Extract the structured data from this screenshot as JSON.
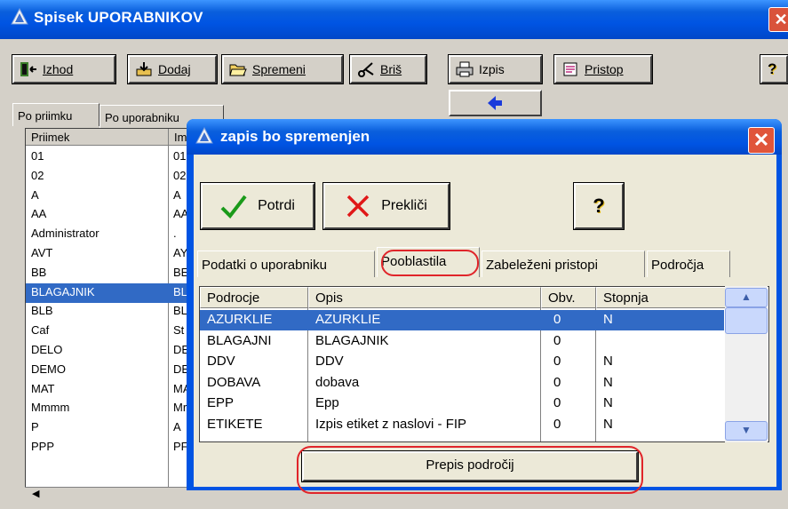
{
  "main_window": {
    "title": "Spisek UPORABNIKOV",
    "toolbar": {
      "exit_label": "Izhod",
      "add_label": "Dodaj",
      "edit_label": "Spremeni",
      "delete_label": "Briš",
      "print_label": "Izpis",
      "access_label": "Pristop",
      "help_icon": "help-icon"
    },
    "tabs": [
      "Po priimku",
      "Po uporabniku"
    ],
    "list": {
      "columns": [
        "Priimek",
        "Im"
      ],
      "rows": [
        [
          "01",
          "01"
        ],
        [
          "02",
          "02"
        ],
        [
          "A",
          "A"
        ],
        [
          "AA",
          "AA"
        ],
        [
          "Administrator",
          "."
        ],
        [
          "AVT",
          "AY"
        ],
        [
          "BB",
          "BE"
        ],
        [
          "BLAGAJNIK",
          "BL"
        ],
        [
          "BLB",
          "BL"
        ],
        [
          "Caf",
          "St"
        ],
        [
          "DELO",
          "DE"
        ],
        [
          "DEMO",
          "DE"
        ],
        [
          "MAT",
          "MA"
        ],
        [
          "Mmmm",
          "Mr"
        ],
        [
          "P",
          "A"
        ],
        [
          "PPP",
          "PF"
        ]
      ],
      "selected_index": 7
    }
  },
  "dialog": {
    "title": "zapis bo spremenjen",
    "confirm_label": "Potrdi",
    "cancel_label": "Prekliči",
    "tabs": [
      "Podatki o uporabniku",
      "Pooblastila",
      "Zabeleženi pristopi",
      "Področja"
    ],
    "active_tab": 1,
    "grid": {
      "columns": [
        "Podrocje",
        "Opis",
        "Obv.",
        "Stopnja"
      ],
      "rows": [
        [
          "AZURKLIE",
          "AZURKLIE",
          "0",
          "N"
        ],
        [
          "BLAGAJNI",
          "BLAGAJNIK",
          "0",
          ""
        ],
        [
          "DDV",
          "DDV",
          "0",
          "N"
        ],
        [
          "DOBAVA",
          "dobava",
          "0",
          "N"
        ],
        [
          "EPP",
          "Epp",
          "0",
          "N"
        ],
        [
          "ETIKETE",
          "Izpis etiket z naslovi - FIP",
          "0",
          "N"
        ]
      ],
      "selected_index": 0
    },
    "copy_button_label": "Prepis področij"
  },
  "colors": {
    "titlebar": "#0054e3",
    "selection": "#316ac5",
    "highlight_ring": "#e0252a"
  }
}
